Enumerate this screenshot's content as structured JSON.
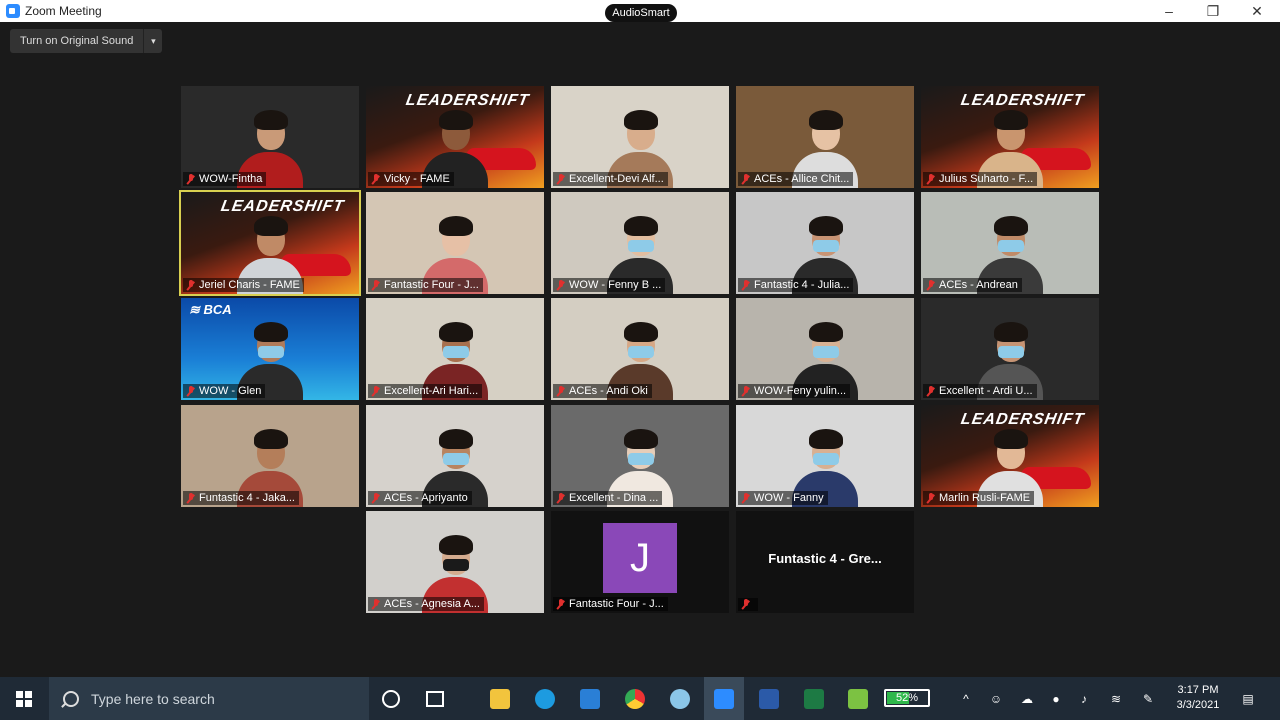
{
  "window": {
    "title": "Zoom Meeting",
    "minimize": "–",
    "restore": "❐",
    "close": "✕",
    "audiosmart": "AudioSmart",
    "original_sound": "Turn on Original Sound",
    "dropdown_glyph": "▾"
  },
  "participants": [
    {
      "name": "WOW-Fintha",
      "bg": "#2a2a2a",
      "skin": "#c99a78",
      "shirt": "#b11d1d",
      "style": "photo"
    },
    {
      "name": "Vicky - FAME",
      "style": "lead",
      "skin": "#8d5a3b",
      "shirt": "#222"
    },
    {
      "name": "Excellent-Devi Alf...",
      "bg": "#d9d3c8",
      "skin": "#d8ad8c",
      "shirt": "#a57a5a",
      "style": "photo"
    },
    {
      "name": "ACEs - Allice Chit...",
      "bg": "#7a5a3a",
      "skin": "#e6c2a4",
      "shirt": "#ddd",
      "style": "photo"
    },
    {
      "name": "Julius Suharto - F...",
      "style": "lead",
      "skin": "#c9956e",
      "shirt": "#d9b48a"
    },
    {
      "name": "Jeriel Charis - FAME",
      "style": "lead",
      "skin": "#c08a66",
      "shirt": "#d0d4d8",
      "active": true
    },
    {
      "name": "Fantastic Four - J...",
      "bg": "#d4c6b4",
      "skin": "#e6c0a6",
      "shirt": "#d46a6a",
      "style": "photo"
    },
    {
      "name": "WOW - Fenny B ...",
      "bg": "#cfc9bf",
      "skin": "#e2bea0",
      "shirt": "#2a2a2a",
      "style": "photo",
      "mask": true
    },
    {
      "name": "Fantastic 4 - Julia...",
      "bg": "#c7c7c7",
      "skin": "#c89474",
      "shirt": "#2a2a2a",
      "style": "photo",
      "mask": true
    },
    {
      "name": "ACEs - Andrean",
      "bg": "#b9bdb7",
      "skin": "#c08b68",
      "shirt": "#3a3a3a",
      "style": "photo",
      "mask": true
    },
    {
      "name": "WOW - Glen",
      "style": "bca",
      "skin": "#b07b5a",
      "shirt": "#2a2a2a",
      "mask": true
    },
    {
      "name": "Excellent-Ari Hari...",
      "bg": "#d6d0c4",
      "skin": "#a8704e",
      "shirt": "#7a2424",
      "style": "photo",
      "mask": true
    },
    {
      "name": "ACEs - Andi Oki",
      "bg": "#d4cec2",
      "skin": "#d6a886",
      "shirt": "#5a3a2a",
      "style": "photo",
      "mask": true
    },
    {
      "name": "WOW-Feny yulin...",
      "bg": "#b8b4ac",
      "skin": "#d8b294",
      "shirt": "#222",
      "style": "photo",
      "mask": true
    },
    {
      "name": "Excellent - Ardi U...",
      "bg": "#2a2a2a",
      "skin": "#c69474",
      "shirt": "#555",
      "style": "photo",
      "mask": true
    },
    {
      "name": "Funtastic 4 - Jaka...",
      "bg": "#b8a38c",
      "skin": "#b47e5a",
      "shirt": "#a54a3a",
      "style": "photo"
    },
    {
      "name": "ACEs - Apriyanto",
      "bg": "#d6d2cc",
      "skin": "#b88460",
      "shirt": "#2a2a2a",
      "style": "photo",
      "mask": true
    },
    {
      "name": "Excellent - Dina ...",
      "bg": "#6a6a6a",
      "skin": "#e6cdb8",
      "shirt": "#f0e8e0",
      "style": "photo",
      "mask": true
    },
    {
      "name": "WOW - Fanny",
      "bg": "#d8d8d8",
      "skin": "#d8b092",
      "shirt": "#2a3a6a",
      "style": "photo",
      "mask": true
    },
    {
      "name": "Marlin Rusli-FAME",
      "style": "lead",
      "skin": "#e2b896",
      "shirt": "#e0e0e0"
    },
    {
      "name": "ACEs - Agnesia A...",
      "bg": "#d2d0cc",
      "skin": "#d4ab8e",
      "shirt": "#c23030",
      "style": "photo",
      "mask": true,
      "mask_color": "#1a1a1a"
    },
    {
      "name": "Fantastic Four - J...",
      "style": "avatar",
      "initial": "J"
    },
    {
      "name": "",
      "style": "nameonly",
      "display_name": "Funtastic 4 - Gre..."
    }
  ],
  "taskbar": {
    "search_placeholder": "Type here to search",
    "battery": "52%",
    "battery_level": 0.52,
    "time": "3:17 PM",
    "date": "3/3/2021"
  },
  "colors": {
    "zoom_blue": "#2d8cff",
    "active_speaker": "#d8d050",
    "muted_red": "#e0302e",
    "avatar_purple": "#8a48b8"
  }
}
